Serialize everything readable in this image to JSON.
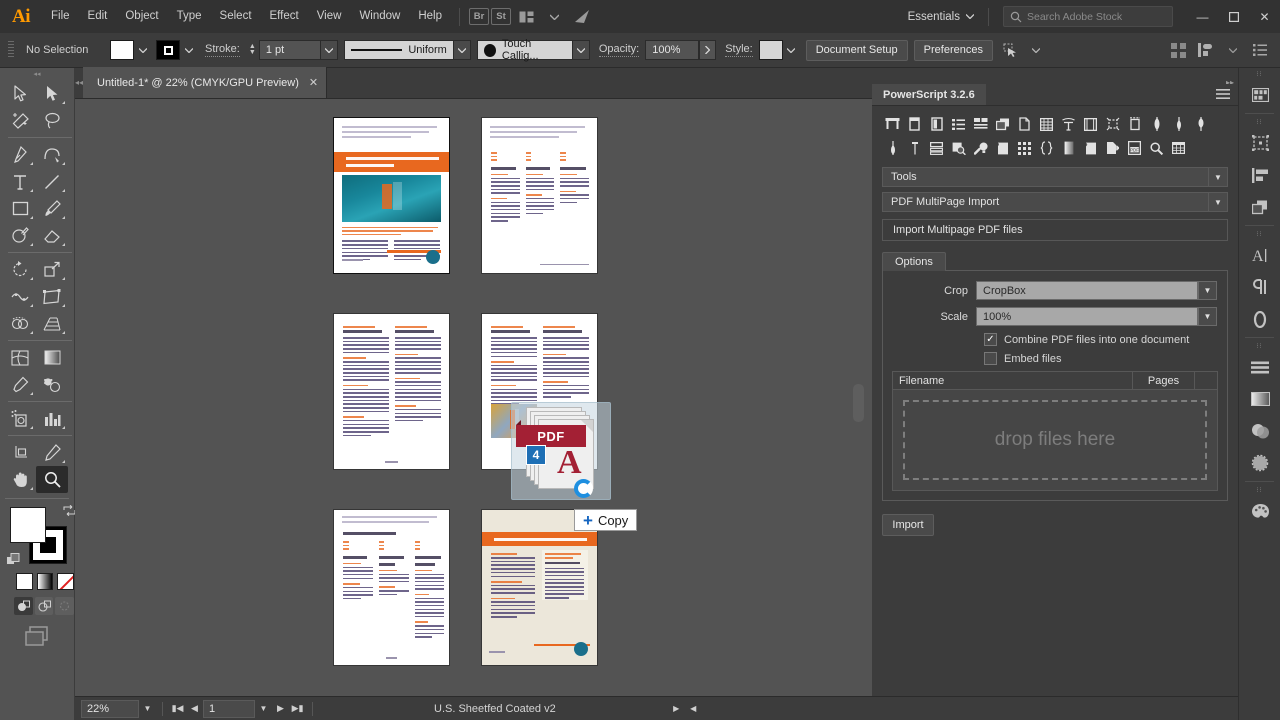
{
  "app": {
    "logo": "Ai",
    "menus": [
      "File",
      "Edit",
      "Object",
      "Type",
      "Select",
      "Effect",
      "View",
      "Window",
      "Help"
    ],
    "bridge_icon_label": "Br",
    "stock_icon_label": "St",
    "workspace": "Essentials",
    "search_placeholder": "Search Adobe Stock",
    "window_minimize": "—",
    "window_maximize": "❐",
    "window_close": "✕"
  },
  "control_bar": {
    "selection_state": "No Selection",
    "fill_color": "#ffffff",
    "stroke_color": "#000000",
    "stroke_label": "Stroke:",
    "stroke_weight": "1 pt",
    "stroke_profile": "Uniform",
    "brush": "Touch Callig...",
    "opacity_label": "Opacity:",
    "opacity_value": "100%",
    "style_label": "Style:",
    "document_setup": "Document Setup",
    "preferences": "Preferences"
  },
  "tools": [
    {
      "name": "selection-tool",
      "glyph": "selection"
    },
    {
      "name": "direct-selection-tool",
      "glyph": "direct"
    },
    {
      "name": "magic-wand-tool",
      "glyph": "wand"
    },
    {
      "name": "lasso-tool",
      "glyph": "lasso"
    },
    {
      "name": "pen-tool",
      "glyph": "pen"
    },
    {
      "name": "curvature-tool",
      "glyph": "curvature"
    },
    {
      "name": "type-tool",
      "glyph": "type"
    },
    {
      "name": "line-segment-tool",
      "glyph": "line"
    },
    {
      "name": "rectangle-tool",
      "glyph": "rect"
    },
    {
      "name": "paintbrush-tool",
      "glyph": "brush"
    },
    {
      "name": "shaper-tool",
      "glyph": "shaper"
    },
    {
      "name": "eraser-tool",
      "glyph": "eraser"
    },
    {
      "name": "rotate-tool",
      "glyph": "rotate"
    },
    {
      "name": "scale-tool",
      "glyph": "scale"
    },
    {
      "name": "width-tool",
      "glyph": "width"
    },
    {
      "name": "free-transform-tool",
      "glyph": "freetransform"
    },
    {
      "name": "shape-builder-tool",
      "glyph": "shapebuilder"
    },
    {
      "name": "perspective-grid-tool",
      "glyph": "perspective"
    },
    {
      "name": "mesh-tool",
      "glyph": "mesh"
    },
    {
      "name": "gradient-tool",
      "glyph": "gradient"
    },
    {
      "name": "eyedropper-tool",
      "glyph": "eyedropper"
    },
    {
      "name": "blend-tool",
      "glyph": "blend"
    },
    {
      "name": "symbol-sprayer-tool",
      "glyph": "symbol"
    },
    {
      "name": "column-graph-tool",
      "glyph": "graph"
    },
    {
      "name": "artboard-tool",
      "glyph": "artboard"
    },
    {
      "name": "slice-tool",
      "glyph": "slice"
    },
    {
      "name": "hand-tool",
      "glyph": "hand"
    },
    {
      "name": "zoom-tool",
      "glyph": "zoom",
      "selected": true
    }
  ],
  "document_tab": {
    "title": "Untitled-1* @ 22% (CMYK/GPU Preview)",
    "close": "✕"
  },
  "canvas": {
    "drag_badge_count": "4",
    "pdf_label": "PDF",
    "copy_tooltip": "Copy",
    "copy_plus": "+",
    "pages": [
      {
        "name": "artboard-page-1"
      },
      {
        "name": "artboard-page-2"
      },
      {
        "name": "artboard-page-3"
      },
      {
        "name": "artboard-page-4"
      },
      {
        "name": "artboard-page-5"
      },
      {
        "name": "artboard-page-6"
      }
    ]
  },
  "panel": {
    "title": "PowerScript 3.2.6",
    "menu_icon": "≡",
    "toolbar_row1": [
      "artboards-icon",
      "page-icon",
      "spread-icon",
      "list-icon",
      "layout-icon",
      "duplicate-icon",
      "document-icon",
      "table-icon",
      "text-path-icon",
      "frame-icon",
      "crop-marks-icon",
      "measure-icon",
      "ruler-left-icon",
      "ruler-mid-icon",
      "ruler-right-icon"
    ],
    "toolbar_row2": [
      "guide-icon",
      "guide-alt-icon",
      "rows-icon",
      "search-doc-icon",
      "wrench-icon",
      "book-icon",
      "grid-icon",
      "braces-icon",
      "gradient-bar-icon",
      "page-curl-icon",
      "export-icon",
      "pdf-icon",
      "magnifier-icon",
      "spreadsheet-icon"
    ],
    "category_select": "Tools",
    "script_select": "PDF MultiPage Import",
    "script_description": "Import Multipage PDF files",
    "options_tab": "Options",
    "crop_label": "Crop",
    "crop_value": "CropBox",
    "scale_label": "Scale",
    "scale_value": "100%",
    "combine_label": "Combine PDF files into one document",
    "combine_checked": true,
    "embed_label": "Embed files",
    "embed_checked": false,
    "filename_col": "Filename",
    "pages_col": "Pages",
    "dropzone_text": "drop files here",
    "import_button": "Import"
  },
  "dock": [
    {
      "name": "dock-libraries-icon"
    },
    {
      "name": "dock-artboards-icon"
    },
    {
      "name": "dock-align-icon"
    },
    {
      "name": "dock-pathfinder-icon"
    },
    {
      "name": "dock-character-icon"
    },
    {
      "name": "dock-paragraph-icon"
    },
    {
      "name": "dock-glyphs-icon"
    },
    {
      "name": "dock-stroke-icon"
    },
    {
      "name": "dock-gradient-icon"
    },
    {
      "name": "dock-transparency-icon"
    },
    {
      "name": "dock-appearance-icon"
    },
    {
      "name": "dock-color-icon"
    }
  ],
  "status_bar": {
    "zoom": "22%",
    "page_number": "1",
    "color_profile": "U.S. Sheetfed Coated v2"
  }
}
